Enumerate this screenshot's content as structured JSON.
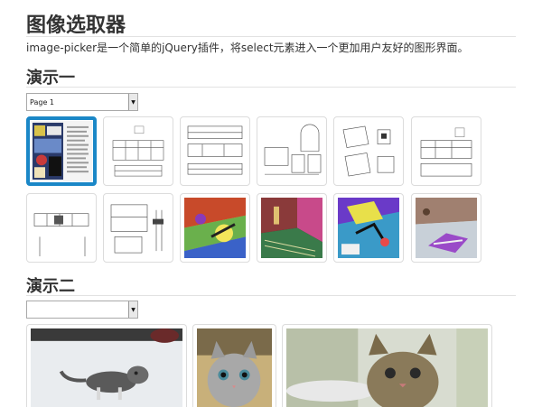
{
  "title": "图像选取器",
  "intro": "image-picker是一个简单的jQuery插件，将select元素进入一个更加用户友好的图形界面。",
  "demo1": {
    "heading": "演示一",
    "select_value": "Page 1",
    "selected_index": 0,
    "thumbnails": [
      {
        "kind": "comic"
      },
      {
        "kind": "plan"
      },
      {
        "kind": "plan"
      },
      {
        "kind": "plan"
      },
      {
        "kind": "plan"
      },
      {
        "kind": "plan"
      },
      {
        "kind": "plan"
      },
      {
        "kind": "plan"
      },
      {
        "kind": "colorful"
      },
      {
        "kind": "colorful"
      },
      {
        "kind": "colorful"
      },
      {
        "kind": "colorful"
      }
    ]
  },
  "demo2": {
    "heading": "演示二",
    "select_value": "",
    "photos": [
      {
        "kind": "kitten-snow"
      },
      {
        "kind": "kitten-face"
      },
      {
        "kind": "kitten-close"
      }
    ]
  },
  "colors": {
    "selected_border": "#1a87c7",
    "heading_text": "#333333",
    "rule": "#e2e2e2"
  }
}
